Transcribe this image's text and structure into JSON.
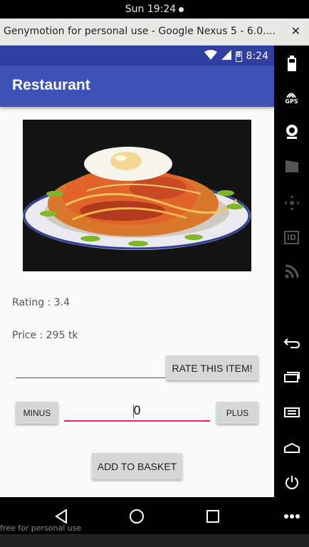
{
  "os": {
    "clock": "Sun 19:24"
  },
  "window": {
    "title": "Genymotion for personal use - Google Nexus 5 - 6.0....",
    "close_label": "✕"
  },
  "status_bar": {
    "time": "8:24",
    "battery_level": "8"
  },
  "app_bar": {
    "title": "Restaurant"
  },
  "item": {
    "rating_text": "Rating : 3.4",
    "price_text": "Price : 295 tk"
  },
  "rate_button_label": "RATE THIS ITEM!",
  "quantity": {
    "minus_label": "MINUS",
    "value": "0",
    "plus_label": "PLUS"
  },
  "basket_button_label": "ADD TO BASKET",
  "emulator_sidebar": {
    "icons": [
      "battery-icon",
      "gps-icon",
      "camera-icon",
      "clapperboard-icon",
      "dpad-icon",
      "id-icon",
      "rss-icon",
      "back-icon",
      "recents-icon",
      "menu-icon",
      "home-icon",
      "power-icon"
    ],
    "gps_label": "GPS",
    "id_label": "ID"
  },
  "nav_bar": {
    "icons": [
      "back-triangle-icon",
      "home-circle-icon",
      "recents-square-icon",
      "more-dots-icon"
    ]
  },
  "watermark": "free for personal use",
  "colors": {
    "primary": "#3f51b5",
    "primary_dark": "#303f9f",
    "accent": "#e91e63"
  }
}
